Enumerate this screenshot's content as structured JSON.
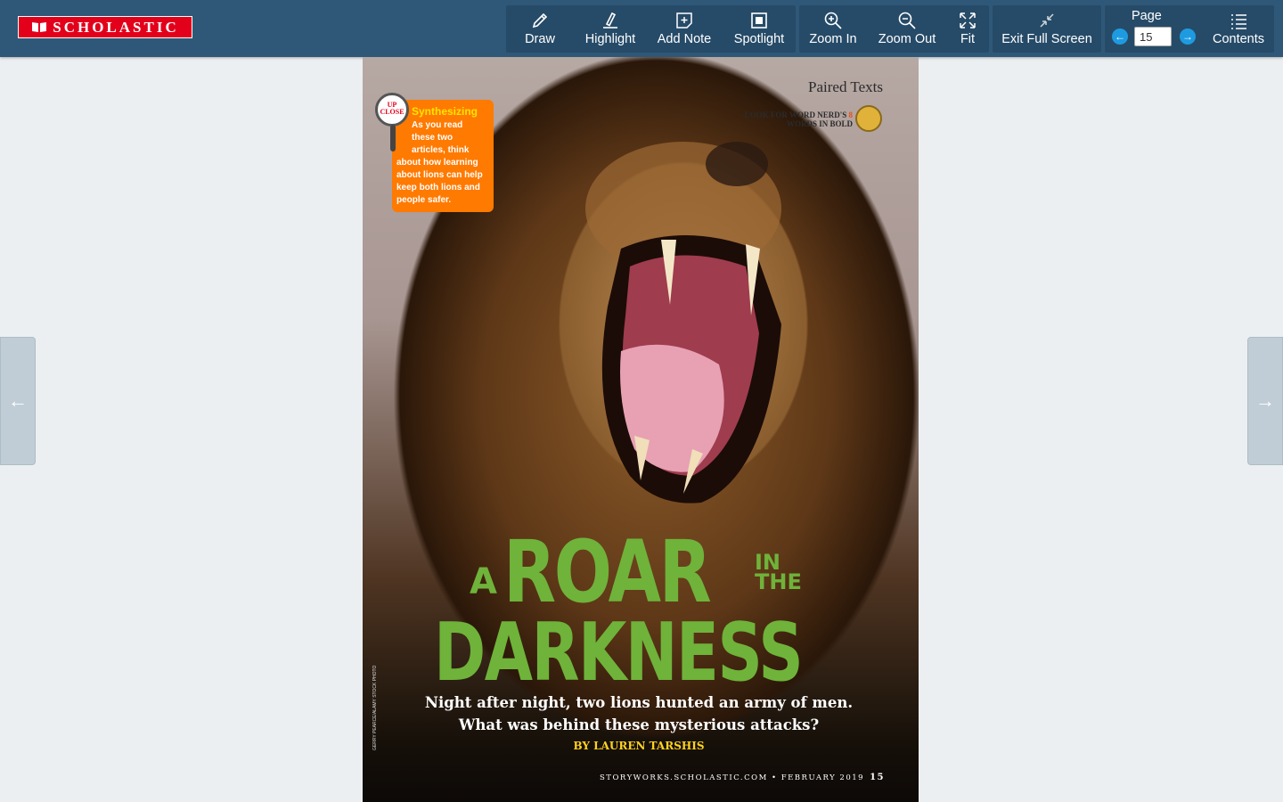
{
  "brand": {
    "logo_text": "SCHOLASTIC"
  },
  "toolbar": {
    "draw": "Draw",
    "highlight": "Highlight",
    "add_note": "Add Note",
    "spotlight": "Spotlight",
    "zoom_in": "Zoom In",
    "zoom_out": "Zoom Out",
    "fit": "Fit",
    "exit_full_screen": "Exit Full Screen",
    "page_label": "Page",
    "page_value": "15",
    "contents": "Contents"
  },
  "icons": {
    "draw": "pencil-icon",
    "highlight": "highlighter-icon",
    "add_note": "add-note-icon",
    "spotlight": "spotlight-icon",
    "zoom_in": "zoom-in-icon",
    "zoom_out": "zoom-out-icon",
    "fit": "expand-icon",
    "exit_full_screen": "collapse-icon",
    "prev_page": "arrow-left-circle-icon",
    "next_page": "arrow-right-circle-icon",
    "contents": "list-icon",
    "side_prev": "arrow-left-icon",
    "side_next": "arrow-right-icon"
  },
  "colors": {
    "topbar": "#2f5878",
    "brand_red": "#e3001b",
    "accent_blue": "#1e9be0",
    "title_green": "#6fb33a"
  },
  "magazine": {
    "section": "Paired Texts",
    "nerd_line1_a": "LOOK FOR WORD NERD'S",
    "nerd_line1_b": "8",
    "nerd_line2": "WORDS IN BOLD",
    "upclose_badge_line1": "UP",
    "upclose_badge_line2": "CLOSE",
    "upclose_heading": "Synthesizing",
    "upclose_body1": "As you read these two articles, think",
    "upclose_body2": "about how learning about lions can help keep both lions and people safer.",
    "title_a": "A",
    "title_roar": "ROAR",
    "title_in": "IN",
    "title_the": "THE",
    "title_darkness": "DARKNESS",
    "dek_line1": "Night after night, two lions hunted an army of men.",
    "dek_line2": "What was behind these mysterious attacks?",
    "byline": "BY LAUREN TARSHIS",
    "folio": "STORYWORKS.SCHOLASTIC.COM • FEBRUARY 2019",
    "page_number": "15",
    "photo_credit": "GERRY PEARCE/ALAMY STOCK PHOTO"
  }
}
